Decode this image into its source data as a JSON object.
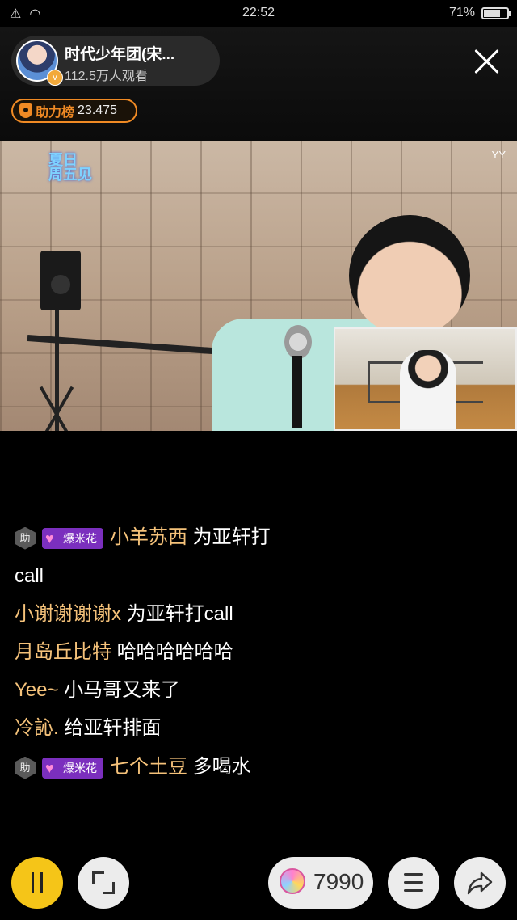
{
  "status_bar": {
    "time": "22:52",
    "battery": "71%",
    "battery_level": 0.71
  },
  "anchor": {
    "name": "时代少年团(宋...",
    "viewers": "112.5万人观看"
  },
  "boost": {
    "label": "助力榜",
    "value": "23.475"
  },
  "video": {
    "show_logo": "夏日\n周五见",
    "watermark": "YY"
  },
  "chat": [
    {
      "guard_badge": "助",
      "pop_badge": "爆米花",
      "nick": "小羊苏西",
      "text": " 为亚轩打",
      "continuation": "call"
    },
    {
      "nick": "小谢谢谢谢x",
      "text": " 为亚轩打call"
    },
    {
      "nick": "月岛丘比特",
      "text": " 哈哈哈哈哈哈"
    },
    {
      "nick": "Yee~",
      "text": " 小马哥又来了"
    },
    {
      "nick": "冷訫.",
      "text": " 给亚轩排面"
    },
    {
      "guard_badge": "助",
      "pop_badge": "爆米花",
      "nick": "七个土豆",
      "text": " 多喝水"
    }
  ],
  "bottom": {
    "gift_count": "7990"
  },
  "icons": [
    "wifi-icon",
    "alert-icon",
    "battery-icon",
    "close-icon",
    "shield-icon",
    "pause-icon",
    "fullscreen-icon",
    "lollipop-icon",
    "menu-icon",
    "share-icon"
  ]
}
